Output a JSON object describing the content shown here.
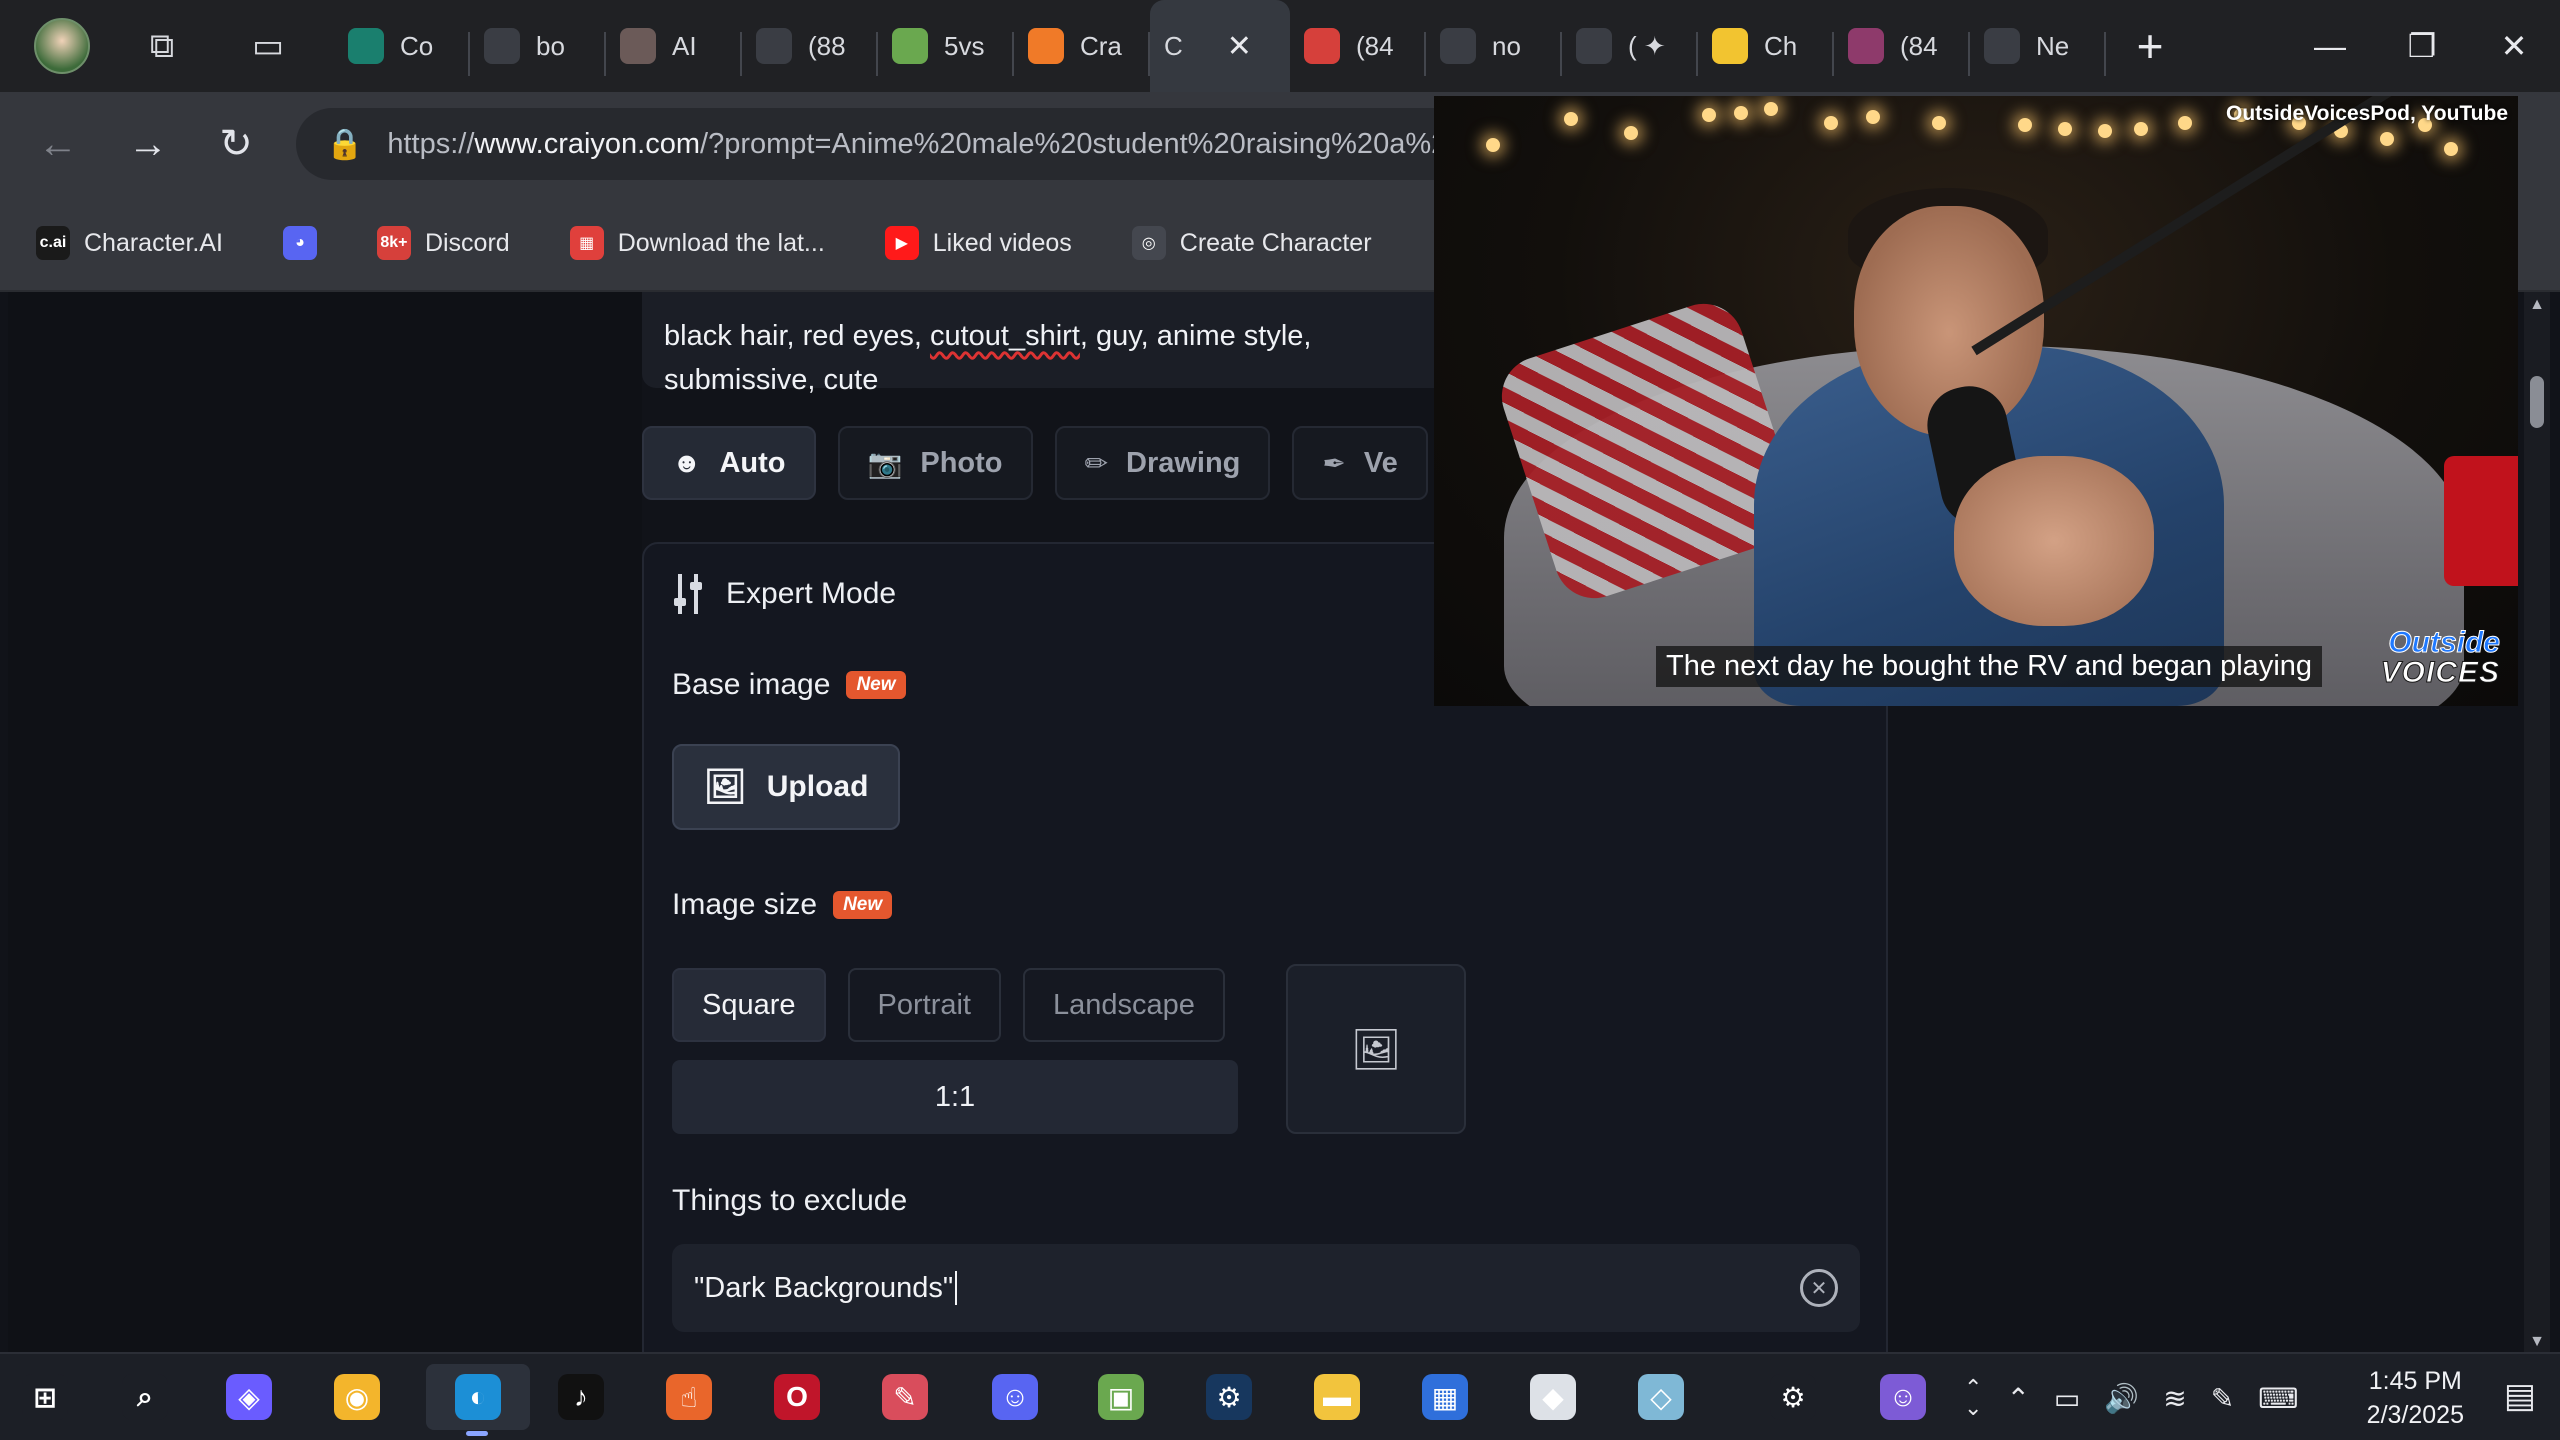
{
  "tabs": [
    {
      "label": "Co",
      "icon": "circle-icon",
      "color": "#1a7f6e"
    },
    {
      "label": "bo",
      "icon": "document-icon",
      "color": "#3a3d44"
    },
    {
      "label": "AI",
      "icon": "avatar-icon",
      "color": "#6b5a58"
    },
    {
      "label": "(88",
      "icon": "media-icon",
      "color": "#3a3d44"
    },
    {
      "label": "5vs",
      "icon": "pinwheel-icon",
      "color": "#6aa84f"
    },
    {
      "label": "Cra",
      "icon": "pencil-icon",
      "color": "#f07a28"
    },
    {
      "label": "C",
      "icon": "",
      "color": "#353940",
      "close": "✕"
    },
    {
      "label": "(84",
      "icon": "badge-8k-icon",
      "color": "#d6403b"
    },
    {
      "label": "no",
      "icon": "document-icon",
      "color": "#3a3d44"
    },
    {
      "label": "( ✦",
      "icon": "roblox-icon",
      "color": "#3a3d44"
    },
    {
      "label": "Ch",
      "icon": "emoji-icon",
      "color": "#f2c430"
    },
    {
      "label": "(84",
      "icon": "badge-8k-icon",
      "color": "#8e3a6b"
    },
    {
      "label": "Ne",
      "icon": "calendar-icon",
      "color": "#3a3d44"
    }
  ],
  "new_tab": "+",
  "window_controls": {
    "minimize": "—",
    "restore": "❐",
    "close": "✕"
  },
  "nav": {
    "back": "←",
    "forward": "→",
    "reload": "↻"
  },
  "url": {
    "prefix": "https://",
    "host": "www.craiyon.com",
    "rest": "/?prompt=Anime%20male%20student%20raising%20a%20"
  },
  "bookmarks": [
    {
      "label": "Character.AI",
      "icon_text": "c.ai",
      "color": "#1a1a1a"
    },
    {
      "label": "",
      "icon_text": "◕",
      "color": "#5865f2"
    },
    {
      "label": "Discord",
      "icon_text": "8k+",
      "color": "#d6403b"
    },
    {
      "label": "Download the lat...",
      "icon_text": "▦",
      "color": "#e0403c"
    },
    {
      "label": "Liked videos",
      "icon_text": "▶",
      "color": "#ff1a1a"
    },
    {
      "label": "Create Character",
      "icon_text": "◎",
      "color": "#44474f"
    },
    {
      "label": "",
      "icon_text": "▯",
      "color": "#35373d"
    }
  ],
  "prompt_text": {
    "before": "black hair, red eyes, ",
    "squiggle": "cutout_shirt",
    "after": ", guy, anime style,",
    "line2": "submissive, cute"
  },
  "modes": [
    {
      "label": "Auto",
      "icon": "☻",
      "active": true
    },
    {
      "label": "Photo",
      "icon": "📷",
      "active": false
    },
    {
      "label": "Drawing",
      "icon": "✏",
      "active": false
    },
    {
      "label": "Ve",
      "icon": "✒",
      "active": false
    }
  ],
  "expert_mode": {
    "title": "Expert Mode"
  },
  "base_image": {
    "label": "Base image",
    "badge": "New",
    "upload_label": "Upload"
  },
  "image_size": {
    "label": "Image size",
    "badge": "New",
    "options": [
      "Square",
      "Portrait",
      "Landscape"
    ],
    "selected": "Square",
    "ratio": "1:1"
  },
  "exclude": {
    "label": "Things to exclude",
    "value": "\"Dark Backgrounds\""
  },
  "video": {
    "credit": "OutsideVoicesPod, YouTube",
    "caption": "The next day he bought the RV and began playing",
    "logo_top": "Outside",
    "logo_bottom": "VOICES"
  },
  "taskbar": {
    "icons": [
      {
        "name": "start-icon",
        "glyph": "⊞",
        "color": "#1c1f26"
      },
      {
        "name": "search-icon",
        "glyph": "⌕",
        "color": "#1c1f26"
      },
      {
        "name": "copilot-icon",
        "glyph": "◈",
        "color": "#6a5cff"
      },
      {
        "name": "chrome-canary-icon",
        "glyph": "◉",
        "color": "#f3b52c"
      },
      {
        "name": "edge-icon",
        "glyph": "◐",
        "color": "#1c8fd6",
        "active": true
      },
      {
        "name": "tiktok-icon",
        "glyph": "♪",
        "color": "#111111"
      },
      {
        "name": "app-hand-icon",
        "glyph": "☝",
        "color": "#e9662b"
      },
      {
        "name": "opera-icon",
        "glyph": "O",
        "color": "#c0152a"
      },
      {
        "name": "paint-icon",
        "glyph": "✎",
        "color": "#d94d5c"
      },
      {
        "name": "discord-icon",
        "glyph": "☺",
        "color": "#5865f2"
      },
      {
        "name": "minecraft-icon",
        "glyph": "▣",
        "color": "#6aa84f"
      },
      {
        "name": "steam-icon",
        "glyph": "⚙",
        "color": "#17375e"
      },
      {
        "name": "file-explorer-icon",
        "glyph": "▬",
        "color": "#f2c43d"
      },
      {
        "name": "store-icon",
        "glyph": "▦",
        "color": "#2f6fdb"
      },
      {
        "name": "roblox-icon",
        "glyph": "◆",
        "color": "#dde1e7"
      },
      {
        "name": "glass-icon",
        "glyph": "◇",
        "color": "#7fb8d6"
      },
      {
        "name": "settings-icon",
        "glyph": "⚙",
        "color": "#1c1f26"
      },
      {
        "name": "avatar-app-icon",
        "glyph": "☺",
        "color": "#7d5bd6"
      }
    ],
    "time": "1:45 PM",
    "date": "2/3/2025"
  }
}
